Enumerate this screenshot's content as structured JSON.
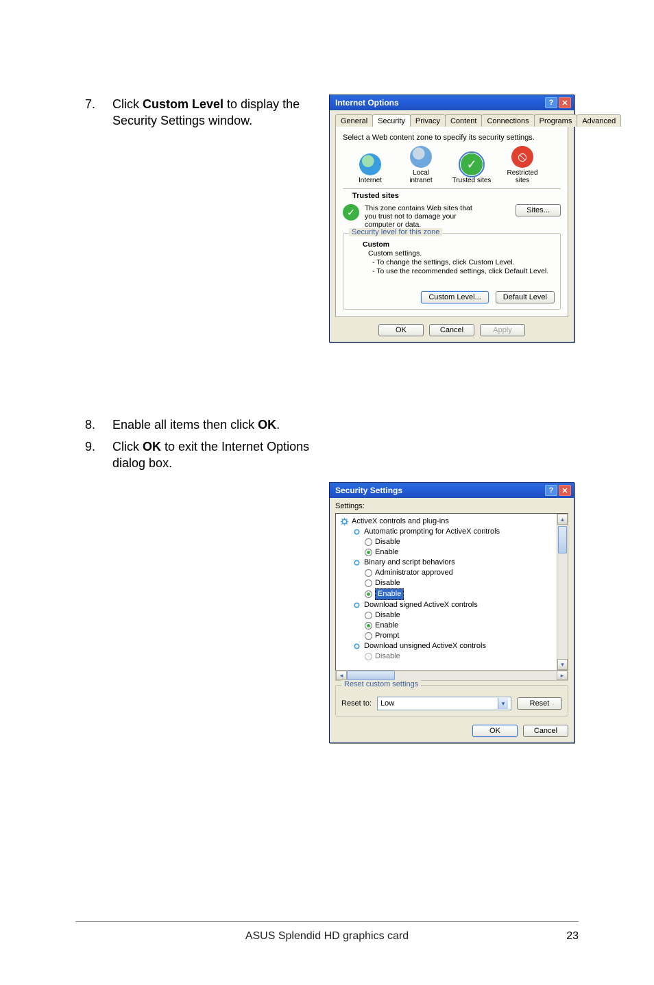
{
  "steps": {
    "s7": {
      "num": "7.",
      "pre": "Click ",
      "bold": "Custom Level",
      "post": " to display the Security Settings window."
    },
    "s8": {
      "num": "8.",
      "pre": "Enable all items then click ",
      "bold": "OK",
      "post": "."
    },
    "s9": {
      "num": "9.",
      "pre": "Click ",
      "bold": "OK",
      "post": " to exit the Internet Options dialog box."
    }
  },
  "io": {
    "title": "Internet Options",
    "tabs": [
      "General",
      "Security",
      "Privacy",
      "Content",
      "Connections",
      "Programs",
      "Advanced"
    ],
    "intro": "Select a Web content zone to specify its security settings.",
    "zones": {
      "internet": "Internet",
      "intranet": "Local intranet",
      "trusted": "Trusted sites",
      "restricted": "Restricted sites"
    },
    "trusted_title": "Trusted sites",
    "trusted_desc": "This zone contains Web sites that you trust not to damage your computer or data.",
    "sites_btn": "Sites...",
    "sec_legend": "Security level for this zone",
    "custom_head": "Custom",
    "custom_l1": "Custom settings.",
    "custom_l2": "- To change the settings, click Custom Level.",
    "custom_l3": "- To use the recommended settings, click Default Level.",
    "custom_level_btn": "Custom Level...",
    "default_level_btn": "Default Level",
    "ok": "OK",
    "cancel": "Cancel",
    "apply": "Apply"
  },
  "ss": {
    "title": "Security Settings",
    "settings_label": "Settings:",
    "nodes": {
      "activex": "ActiveX controls and plug-ins",
      "autoprompt": "Automatic prompting for ActiveX controls",
      "disable": "Disable",
      "enable": "Enable",
      "binary": "Binary and script behaviors",
      "admin": "Administrator approved",
      "dl_signed": "Download signed ActiveX controls",
      "prompt": "Prompt",
      "dl_unsigned": "Download unsigned ActiveX controls",
      "cutoff": "Disable"
    },
    "reset_legend": "Reset custom settings",
    "reset_to_label": "Reset to:",
    "reset_value": "Low",
    "reset_btn": "Reset",
    "ok": "OK",
    "cancel": "Cancel"
  },
  "footer": {
    "text": "ASUS Splendid HD graphics card",
    "page": "23"
  }
}
